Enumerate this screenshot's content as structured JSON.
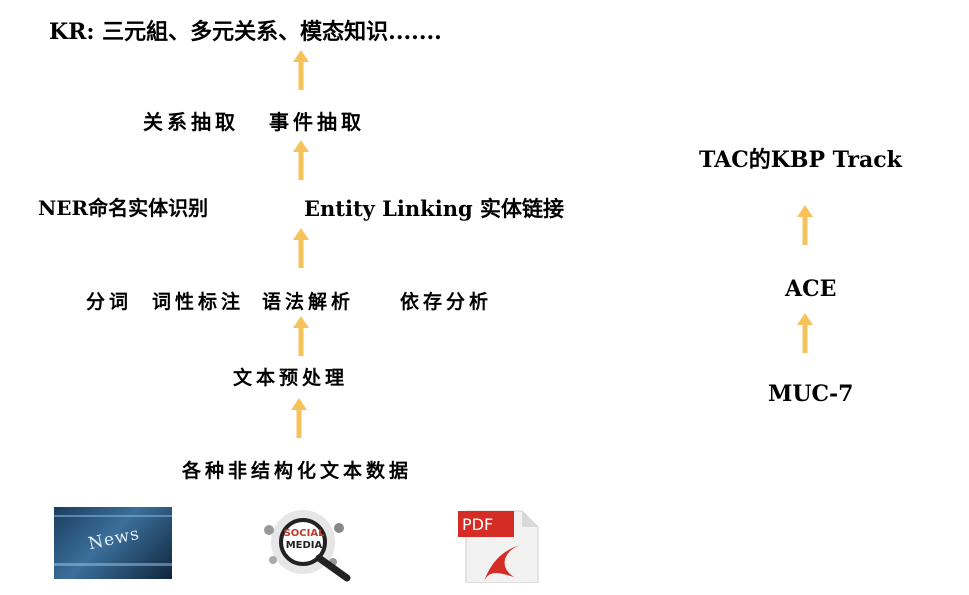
{
  "left_stack": {
    "kr": "KR: 三元組、多元关系、模态知识.......",
    "relation_extraction": "关系抽取",
    "event_extraction": "事件抽取",
    "ner": "NER命名实体识别",
    "entity_linking": "Entity Linking 实体链接",
    "seg": "分词",
    "pos": "词性标注",
    "parse": "语法解析",
    "dep": "依存分析",
    "preprocess": "文本预处理",
    "raw": "各种非结构化文本数据"
  },
  "sources": {
    "news_text": "News",
    "social_text_1": "SOCIAL",
    "social_text_2": "MEDIA",
    "pdf_text": "PDF"
  },
  "right_stack": {
    "tac": "TAC的KBP Track",
    "ace": "ACE",
    "muc": "MUC-7"
  },
  "colors": {
    "arrow": "#F6C35B",
    "pdf_red": "#d42d26",
    "news_blue": "#2f5f86"
  }
}
